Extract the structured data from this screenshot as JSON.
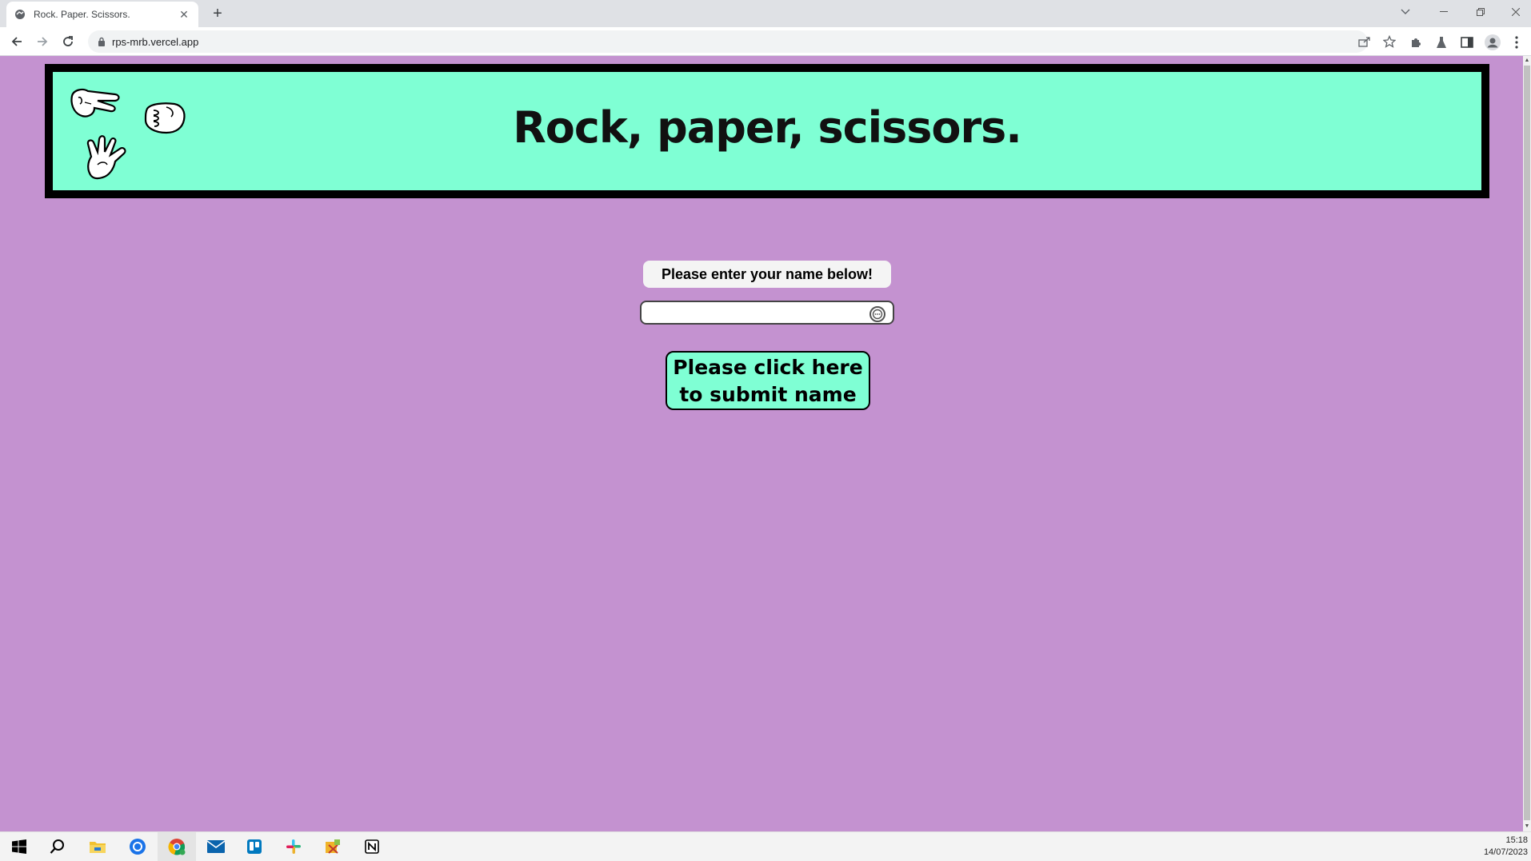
{
  "browser": {
    "tab_title": "Rock. Paper. Scissors.",
    "url": "rps-mrb.vercel.app",
    "icons": [
      "back-icon",
      "forward-icon",
      "reload-icon",
      "lock-icon",
      "share-icon",
      "star-icon",
      "extensions-icon",
      "labs-icon",
      "sidepanel-icon",
      "profile-icon",
      "menu-icon"
    ]
  },
  "page": {
    "banner_title": "Rock, paper, scissors.",
    "prompt": "Please enter your name below!",
    "name_input": {
      "value": "",
      "placeholder": ""
    },
    "submit_label": "Please click here to submit name",
    "colors": {
      "background": "#c492d0",
      "banner": "#7fffd4",
      "border": "#000000"
    }
  },
  "taskbar": {
    "apps": [
      "start-icon",
      "search-icon",
      "file-explorer-icon",
      "chrome-icon",
      "chrome-profile-icon",
      "mail-icon",
      "trello-icon",
      "slack-icon",
      "app-icon",
      "notion-icon"
    ],
    "time": "15:18",
    "date": "14/07/2023"
  }
}
